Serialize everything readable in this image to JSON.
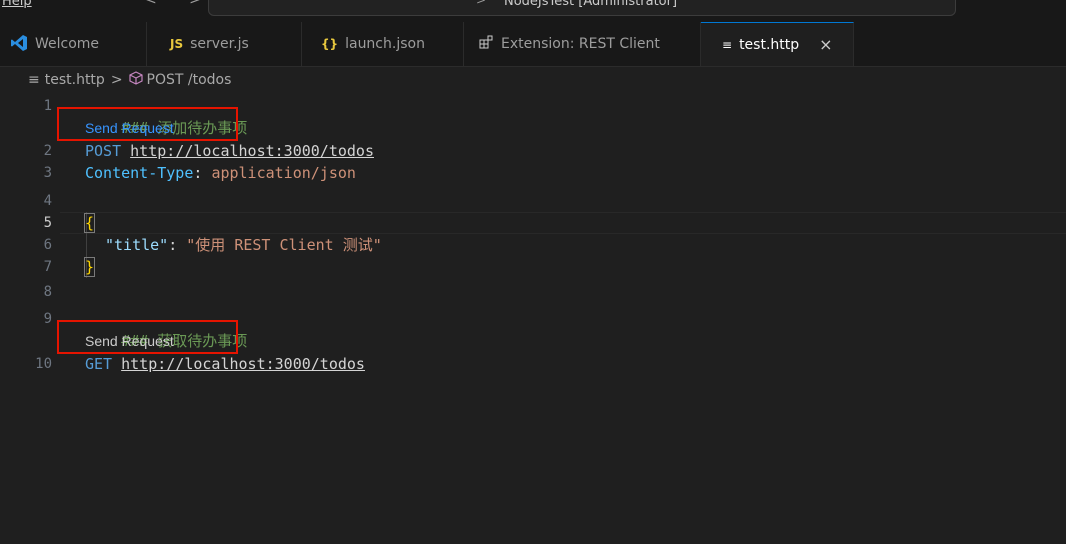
{
  "titlebar": {
    "menu_help": "Help",
    "nav_arrows": "< >",
    "search_text": "NodeJsTest [Administrator]"
  },
  "tabs": [
    {
      "label": "Welcome",
      "icon": "vscode-logo-icon"
    },
    {
      "label": "server.js",
      "icon": "js-file-icon",
      "icon_text": "JS"
    },
    {
      "label": "launch.json",
      "icon": "json-file-icon",
      "icon_text": "{}"
    },
    {
      "label": "Extension: REST Client",
      "icon": "extension-icon"
    },
    {
      "label": "test.http",
      "icon": "http-file-icon",
      "icon_text": "≡",
      "close": "×",
      "active": true
    }
  ],
  "breadcrumb": {
    "file": "test.http",
    "separator": ">",
    "symbol": "POST /todos"
  },
  "editor": {
    "code_lens_label": "Send Request",
    "line_numbers": [
      "1",
      "2",
      "3",
      "4",
      "5",
      "6",
      "7",
      "8",
      "9",
      "10"
    ],
    "lines": {
      "l1": "### 添加待办事项",
      "l2_method": "POST",
      "l2_url": "http://localhost:3000/todos",
      "l3_header": "Content-Type",
      "l3_colon": ": ",
      "l3_value": "application/json",
      "l5": "{",
      "l6_key": "\"title\"",
      "l6_colon": ": ",
      "l6_value": "\"使用 REST Client 测试\"",
      "l7": "}",
      "l9": "### 获取待办事项",
      "l10_method": "GET",
      "l10_url": "http://localhost:3000/todos"
    }
  },
  "colors": {
    "accent": "#0078d4",
    "highlight_box": "#e51400",
    "code_lens": "#3794ff"
  }
}
